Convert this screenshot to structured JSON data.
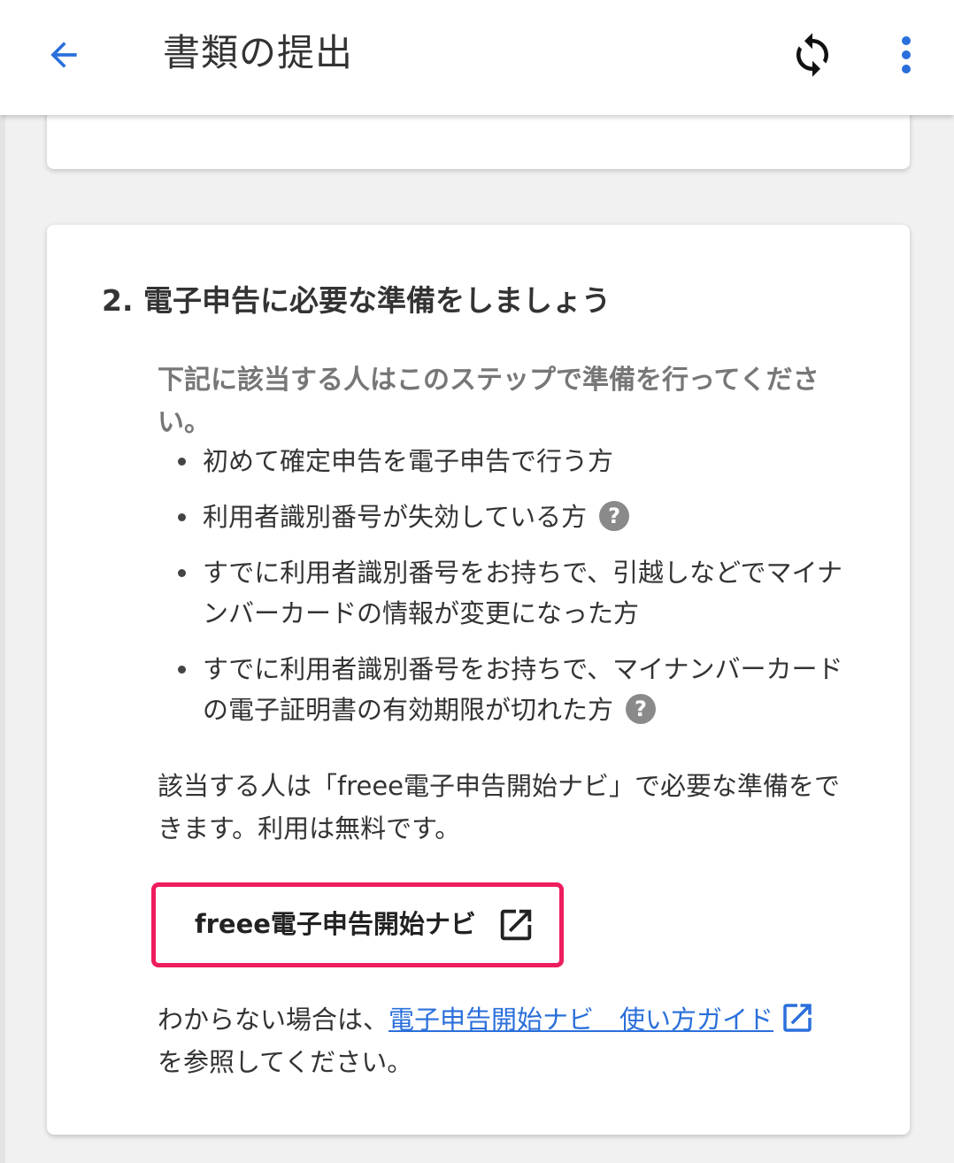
{
  "appbar": {
    "title": "書類の提出",
    "back_icon": "arrow-left-icon",
    "sync_icon": "sync-icon",
    "more_icon": "more-vertical-icon",
    "accent_color": "#2a6fdb"
  },
  "section": {
    "title": "2. 電子申告に必要な準備をしましょう",
    "intro": "下記に該当する人はこのステップで準備を行ってください。",
    "bullets": [
      {
        "text": "初めて確定申告を電子申告で行う方",
        "has_help": false
      },
      {
        "text": "利用者識別番号が失効している方",
        "has_help": true
      },
      {
        "text": "すでに利用者識別番号をお持ちで、引越しなどでマイナンバーカードの情報が変更になった方",
        "has_help": false
      },
      {
        "text": "すでに利用者識別番号をお持ちで、マイナンバーカードの電子証明書の有効期限が切れた方",
        "has_help": true
      }
    ],
    "help_glyph": "?",
    "note": "該当する人は「freee電子申告開始ナビ」で必要な準備をできます。利用は無料です。",
    "navi_button": {
      "label": "freee電子申告開始ナビ",
      "icon": "external-link-icon",
      "highlight_color": "#ee1d5d"
    },
    "guide": {
      "prefix": "わからない場合は、",
      "link_text": "電子申告開始ナビ　使い方ガイド",
      "suffix": "を参照してください。",
      "link_icon": "external-link-icon"
    }
  }
}
